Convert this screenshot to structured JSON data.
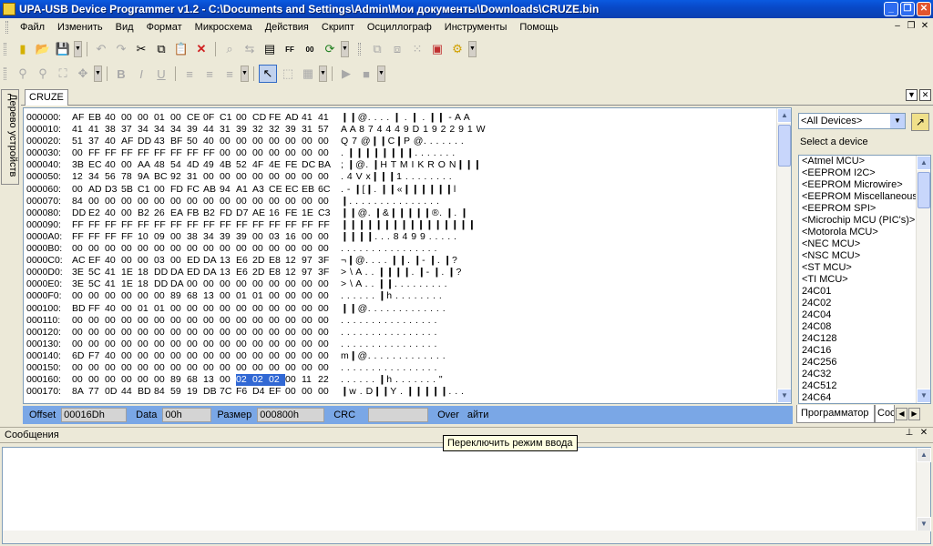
{
  "window": {
    "title": "UPA-USB Device Programmer v1.2 - C:\\Documents and Settings\\Admin\\Мои документы\\Downloads\\CRUZE.bin"
  },
  "menu": [
    "Файл",
    "Изменить",
    "Вид",
    "Формат",
    "Микросхема",
    "Действия",
    "Скрипт",
    "Осциллограф",
    "Инструменты",
    "Помощь"
  ],
  "left_dock_tab": "Дерево устройств",
  "document_tab": "CRUZE",
  "hex_rows": [
    {
      "addr": "000000:",
      "bytes": [
        "AF",
        "EB",
        "40",
        "00",
        "00",
        "01",
        "00",
        "CE",
        "0F",
        "C1",
        "00",
        "CD",
        "FE",
        "AD",
        "41",
        "41"
      ],
      "ascii": "❙❙@. . . . ❙ . ❙ . ❙❙ - A A"
    },
    {
      "addr": "000010:",
      "bytes": [
        "41",
        "41",
        "38",
        "37",
        "34",
        "34",
        "34",
        "39",
        "44",
        "31",
        "39",
        "32",
        "32",
        "39",
        "31",
        "57"
      ],
      "ascii": "A A 8 7 4 4 4 9 D 1 9 2 2 9 1 W"
    },
    {
      "addr": "000020:",
      "bytes": [
        "51",
        "37",
        "40",
        "AF",
        "DD",
        "43",
        "BF",
        "50",
        "40",
        "00",
        "00",
        "00",
        "00",
        "00",
        "00",
        "00"
      ],
      "ascii": "Q 7 @❙❙C❙P @. . . . . . ."
    },
    {
      "addr": "000030:",
      "bytes": [
        "00",
        "FF",
        "FF",
        "FF",
        "FF",
        "FF",
        "FF",
        "FF",
        "FF",
        "00",
        "00",
        "00",
        "00",
        "00",
        "00",
        "00"
      ],
      "ascii": ". ❙❙❙❙❙❙❙❙. . . . . . ."
    },
    {
      "addr": "000040:",
      "bytes": [
        "3B",
        "EC",
        "40",
        "00",
        "AA",
        "48",
        "54",
        "4D",
        "49",
        "4B",
        "52",
        "4F",
        "4E",
        "FE",
        "DC",
        "BA"
      ],
      "ascii": "; ❙@. ❙H T M I K R O N❙❙❙"
    },
    {
      "addr": "000050:",
      "bytes": [
        "12",
        "34",
        "56",
        "78",
        "9A",
        "BC",
        "92",
        "31",
        "00",
        "00",
        "00",
        "00",
        "00",
        "00",
        "00",
        "00"
      ],
      "ascii": ". 4 V x❙❙❙1 . . . . . . . ."
    },
    {
      "addr": "000060:",
      "bytes": [
        "00",
        "AD",
        "D3",
        "5B",
        "C1",
        "00",
        "FD",
        "FC",
        "AB",
        "94",
        "A1",
        "A3",
        "CE",
        "EC",
        "EB",
        "6C"
      ],
      "ascii": ". - ❙[❙. ❙❙«❙❙❙❙❙❙l"
    },
    {
      "addr": "000070:",
      "bytes": [
        "84",
        "00",
        "00",
        "00",
        "00",
        "00",
        "00",
        "00",
        "00",
        "00",
        "00",
        "00",
        "00",
        "00",
        "00",
        "00"
      ],
      "ascii": "❙. . . . . . . . . . . . . . ."
    },
    {
      "addr": "000080:",
      "bytes": [
        "DD",
        "E2",
        "40",
        "00",
        "B2",
        "26",
        "EA",
        "FB",
        "B2",
        "FD",
        "D7",
        "AE",
        "16",
        "FE",
        "1E",
        "C3"
      ],
      "ascii": "❙❙@. ❙&❙❙❙❙❙®. ❙. ❙"
    },
    {
      "addr": "000090:",
      "bytes": [
        "FF",
        "FF",
        "FF",
        "FF",
        "FF",
        "FF",
        "FF",
        "FF",
        "FF",
        "FF",
        "FF",
        "FF",
        "FF",
        "FF",
        "FF",
        "FF"
      ],
      "ascii": "❙❙❙❙❙❙❙❙❙❙❙❙❙❙❙❙"
    },
    {
      "addr": "0000A0:",
      "bytes": [
        "FF",
        "FF",
        "FF",
        "FF",
        "10",
        "09",
        "00",
        "38",
        "34",
        "39",
        "39",
        "00",
        "03",
        "16",
        "00",
        "00"
      ],
      "ascii": "❙❙❙❙. . . 8 4 9 9 . . . . ."
    },
    {
      "addr": "0000B0:",
      "bytes": [
        "00",
        "00",
        "00",
        "00",
        "00",
        "00",
        "00",
        "00",
        "00",
        "00",
        "00",
        "00",
        "00",
        "00",
        "00",
        "00"
      ],
      "ascii": ". . . . . . . . . . . . . . . ."
    },
    {
      "addr": "0000C0:",
      "bytes": [
        "AC",
        "EF",
        "40",
        "00",
        "00",
        "03",
        "00",
        "ED",
        "DA",
        "13",
        "E6",
        "2D",
        "E8",
        "12",
        "97",
        "3F"
      ],
      "ascii": "¬❙@. . . . ❙❙. ❙- ❙. ❙?"
    },
    {
      "addr": "0000D0:",
      "bytes": [
        "3E",
        "5C",
        "41",
        "1E",
        "18",
        "DD",
        "DA",
        "ED",
        "DA",
        "13",
        "E6",
        "2D",
        "E8",
        "12",
        "97",
        "3F"
      ],
      "ascii": "> \\ A . . ❙❙❙❙. ❙- ❙. ❙?"
    },
    {
      "addr": "0000E0:",
      "bytes": [
        "3E",
        "5C",
        "41",
        "1E",
        "18",
        "DD",
        "DA",
        "00",
        "00",
        "00",
        "00",
        "00",
        "00",
        "00",
        "00",
        "00"
      ],
      "ascii": "> \\ A . . ❙❙. . . . . . . . ."
    },
    {
      "addr": "0000F0:",
      "bytes": [
        "00",
        "00",
        "00",
        "00",
        "00",
        "00",
        "89",
        "68",
        "13",
        "00",
        "01",
        "01",
        "00",
        "00",
        "00",
        "00"
      ],
      "ascii": ". . . . . . ❙h . . . . . . . ."
    },
    {
      "addr": "000100:",
      "bytes": [
        "BD",
        "FF",
        "40",
        "00",
        "01",
        "01",
        "00",
        "00",
        "00",
        "00",
        "00",
        "00",
        "00",
        "00",
        "00",
        "00"
      ],
      "ascii": "❙❙@. . . . . . . . . . . . ."
    },
    {
      "addr": "000110:",
      "bytes": [
        "00",
        "00",
        "00",
        "00",
        "00",
        "00",
        "00",
        "00",
        "00",
        "00",
        "00",
        "00",
        "00",
        "00",
        "00",
        "00"
      ],
      "ascii": ". . . . . . . . . . . . . . . ."
    },
    {
      "addr": "000120:",
      "bytes": [
        "00",
        "00",
        "00",
        "00",
        "00",
        "00",
        "00",
        "00",
        "00",
        "00",
        "00",
        "00",
        "00",
        "00",
        "00",
        "00"
      ],
      "ascii": ". . . . . . . . . . . . . . . ."
    },
    {
      "addr": "000130:",
      "bytes": [
        "00",
        "00",
        "00",
        "00",
        "00",
        "00",
        "00",
        "00",
        "00",
        "00",
        "00",
        "00",
        "00",
        "00",
        "00",
        "00"
      ],
      "ascii": ". . . . . . . . . . . . . . . ."
    },
    {
      "addr": "000140:",
      "bytes": [
        "6D",
        "F7",
        "40",
        "00",
        "00",
        "00",
        "00",
        "00",
        "00",
        "00",
        "00",
        "00",
        "00",
        "00",
        "00",
        "00"
      ],
      "ascii": "m❙@. . . . . . . . . . . . ."
    },
    {
      "addr": "000150:",
      "bytes": [
        "00",
        "00",
        "00",
        "00",
        "00",
        "00",
        "00",
        "00",
        "00",
        "00",
        "00",
        "00",
        "00",
        "00",
        "00",
        "00"
      ],
      "ascii": ". . . . . . . . . . . . . . . ."
    },
    {
      "addr": "000160:",
      "bytes": [
        "00",
        "00",
        "00",
        "00",
        "00",
        "00",
        "89",
        "68",
        "13",
        "00",
        "02",
        "02",
        "02",
        "00",
        "11",
        "22"
      ],
      "ascii": ". . . . . . ❙h . . . . . . . \"",
      "selected": [
        10,
        11,
        12
      ]
    },
    {
      "addr": "000170:",
      "bytes": [
        "8A",
        "77",
        "0D",
        "44",
        "BD",
        "84",
        "59",
        "19",
        "DB",
        "7C",
        "F6",
        "D4",
        "EF",
        "00",
        "00",
        "00"
      ],
      "ascii": "❙w . D❙❙Y . ❙❙❙❙❙. . ."
    }
  ],
  "fields": {
    "offset_label": "Offset",
    "offset_value": "00016Dh",
    "data_label": "Data",
    "data_value": "00h",
    "size_label": "Размер",
    "size_value": "000800h",
    "crc_label": "CRC",
    "crc_value": "",
    "over_label": "Over",
    "over_suffix": "айти"
  },
  "device_panel": {
    "filter_value": "<All Devices>",
    "hint": "Select a device",
    "devices": [
      "<Atmel MCU>",
      "<EEPROM I2C>",
      "<EEPROM Microwire>",
      "<EEPROM Miscellaneous>",
      "<EEPROM SPI>",
      "<Microchip MCU (PIC's)>",
      "<Motorola MCU>",
      "<NEC MCU>",
      "<NSC MCU>",
      "<ST MCU>",
      "<TI MCU>",
      "24C01",
      "24C02",
      "24C04",
      "24C08",
      "24C128",
      "24C16",
      "24C256",
      "24C32",
      "24C512",
      "24C64"
    ],
    "tabs": [
      "Программатор",
      "Сос"
    ]
  },
  "messages": {
    "title": "Сообщения"
  },
  "tooltip": "Переключить режим ввода",
  "icons": {
    "toolbar1": [
      "new-icon",
      "open-icon",
      "save-icon",
      "undo-icon",
      "redo-icon",
      "cut-icon",
      "copy-icon",
      "paste-icon",
      "delete-icon",
      "find-icon",
      "replace-icon",
      "page-icon",
      "fill-icon",
      "hex-icon",
      "refresh-icon"
    ],
    "toolbar2": [
      "zoom-in-icon",
      "zoom-out-icon",
      "fit-icon",
      "move-icon",
      "bold-icon",
      "italic-icon",
      "underline-icon",
      "align-left-icon",
      "align-center-icon",
      "align-right-icon",
      "pointer-icon",
      "select-icon",
      "chip-icon",
      "play-icon",
      "stop-icon"
    ]
  }
}
